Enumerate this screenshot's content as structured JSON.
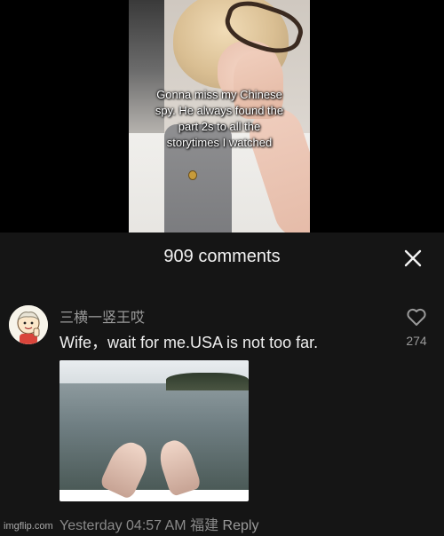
{
  "video": {
    "caption_lines": [
      "Gonna miss my Chinese",
      "spy. He always found the",
      "part 2s to all the",
      "storytimes I watched"
    ]
  },
  "comments_panel": {
    "title": "909 comments",
    "close_icon": "close-icon",
    "comment": {
      "username": "三横一竖王哎",
      "text": "Wife，wait for me.USA is not too far.",
      "like_count": "274",
      "like_icon": "heart-outline-icon",
      "timestamp": "Yesterday 04:57 AM",
      "location": "福建",
      "reply_label": "Reply"
    }
  },
  "watermark": "imgflip.com",
  "colors": {
    "panel_bg": "#151515",
    "primary_text": "#efefef",
    "secondary_text": "#9a9a9a"
  }
}
